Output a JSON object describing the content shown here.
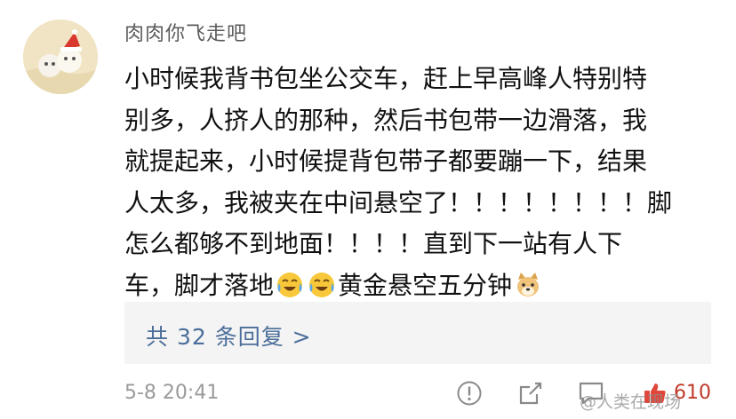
{
  "comment": {
    "username": "肉肉你飞走吧",
    "text_part1": "小时候我背书包坐公交车，赶上早高峰人特别特\n别多，人挤人的那种，然后书包带一边滑落，我\n就提起来，小时候提背包带子都要蹦一下，结果\n人太多，我被夹在中间悬空了！！！！！！！！脚\n怎么都够不到地面！！！！直到下一站有人下\n车，脚才落地",
    "text_part2": "黄金悬空五分钟",
    "emojis": [
      "crying-laughing-emoji",
      "crying-laughing-emoji",
      "doge-emoji"
    ],
    "replies_label": "共 32 条回复 >",
    "timestamp": "5-8 20:41",
    "like_count": "610"
  },
  "actions": [
    "report-icon",
    "share-icon",
    "comment-icon",
    "like-icon"
  ],
  "watermark": "@人类在现场",
  "colors": {
    "reply_link": "#4b6e9a",
    "like": "#e0463a",
    "reply_box_bg": "#f4f4f4"
  }
}
